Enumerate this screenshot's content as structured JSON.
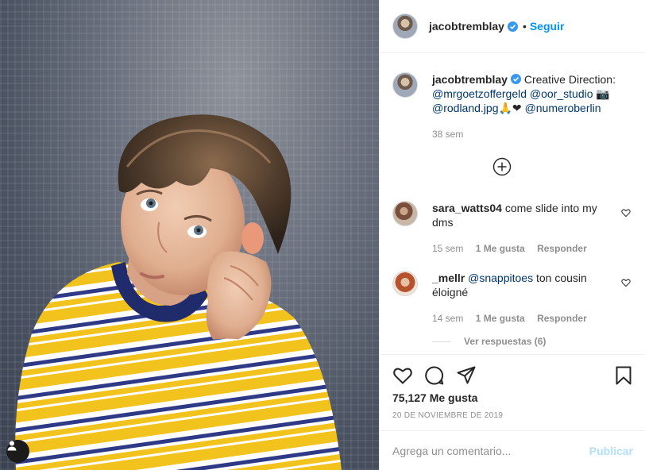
{
  "post": {
    "username": "jacobtremblay",
    "follow_separator": "•",
    "follow_label": "Seguir"
  },
  "caption": {
    "username": "jacobtremblay",
    "text_lead": "Creative Direction:",
    "mention1": "@mrgoetzoffergeld",
    "mention2": "@oor_studio",
    "emoji1": "📷",
    "mention3": "@rodland.jpg",
    "emoji2": "🙏❤",
    "mention4": "@numeroberlin",
    "time": "38 sem"
  },
  "comments": [
    {
      "username": "sara_watts04",
      "text": "come slide into my dms",
      "time": "15 sem",
      "likes": "1 Me gusta",
      "reply_label": "Responder"
    },
    {
      "username": "_mellr",
      "mention": "@snappitoes",
      "text": "ton cousin éloigné",
      "time": "14 sem",
      "likes": "1 Me gusta",
      "reply_label": "Responder"
    }
  ],
  "replies_label": "Ver respuestas (6)",
  "likes_count": "75,127 Me gusta",
  "post_date": "20 DE NOVIEMBRE DE 2019",
  "comment_box": {
    "placeholder": "Agrega un comentario...",
    "publish_label": "Publicar"
  },
  "icons": {
    "verified": "verified-badge-icon",
    "load_more": "plus-circle-icon",
    "like": "heart-icon",
    "comment": "comment-bubble-icon",
    "share": "paper-plane-icon",
    "save": "bookmark-icon",
    "tag": "user-tag-icon"
  },
  "colors": {
    "accent": "#0095f6",
    "mention": "#00376b",
    "muted": "#8e8e8e",
    "publish_disabled": "#b2dffc"
  }
}
